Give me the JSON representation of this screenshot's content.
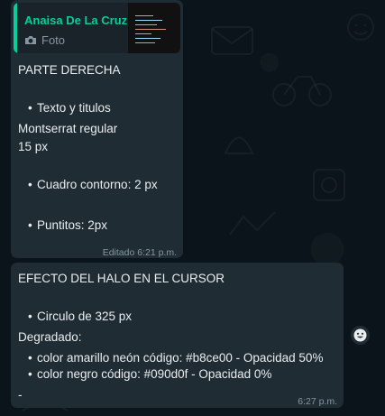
{
  "message1": {
    "quote": {
      "author": "Anaisa De La Cruz",
      "type_label": "Foto"
    },
    "lines": {
      "heading": "PARTE  DERECHA",
      "bullet1": "Texto y titulos",
      "font_name": "Montserrat regular",
      "font_size": "15 px",
      "bullet2": "Cuadro contorno: 2 px",
      "bullet3": "Puntitos: 2px"
    },
    "timestamp": "Editado 6:21 p.m."
  },
  "message2": {
    "heading": "EFECTO DEL HALO EN EL CURSOR",
    "bullet1": "Circulo de 325 px",
    "gradient_label": "Degradado:",
    "bullet2": "color amarillo neón código: #b8ce00 - Opacidad 50%",
    "bullet3": "color negro código: #090d0f - Opacidad 0%",
    "trailing": "-",
    "timestamp": "6:27 p.m."
  },
  "colors": {
    "accent": "#06cf9c",
    "bubble": "#202c33",
    "background": "#0b141a",
    "meta_text": "#8696a0"
  },
  "icons": {
    "quote_media": "camera-icon",
    "reaction": "emoji-icon"
  }
}
